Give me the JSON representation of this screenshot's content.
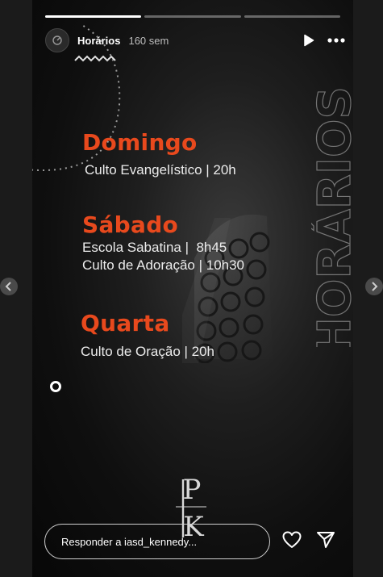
{
  "story": {
    "username": "Horários",
    "time_ago": "160 sem",
    "progress": [
      1.0,
      0.0,
      0.0
    ]
  },
  "graphic": {
    "vertical_word": "HORÁRIOS",
    "logo_text": "PK"
  },
  "schedule": [
    {
      "day": "Domingo",
      "lines": [
        "Culto Evangelístico | 20h"
      ]
    },
    {
      "day": "Sábado",
      "lines": [
        "Escola Sabatina |  8h45",
        "Culto de Adoração | 10h30"
      ]
    },
    {
      "day": "Quarta",
      "lines": [
        "Culto de Oração | 20h"
      ]
    }
  ],
  "reply": {
    "placeholder": "Responder a iasd_kennedy..."
  },
  "colors": {
    "accent": "#e8491d",
    "text": "#ececec",
    "background": "#0f0f0f"
  },
  "icons": {
    "play": "play-icon",
    "more": "more-icon",
    "heart": "heart-icon",
    "send": "send-icon",
    "prev": "chevron-left-icon",
    "next": "chevron-right-icon"
  }
}
